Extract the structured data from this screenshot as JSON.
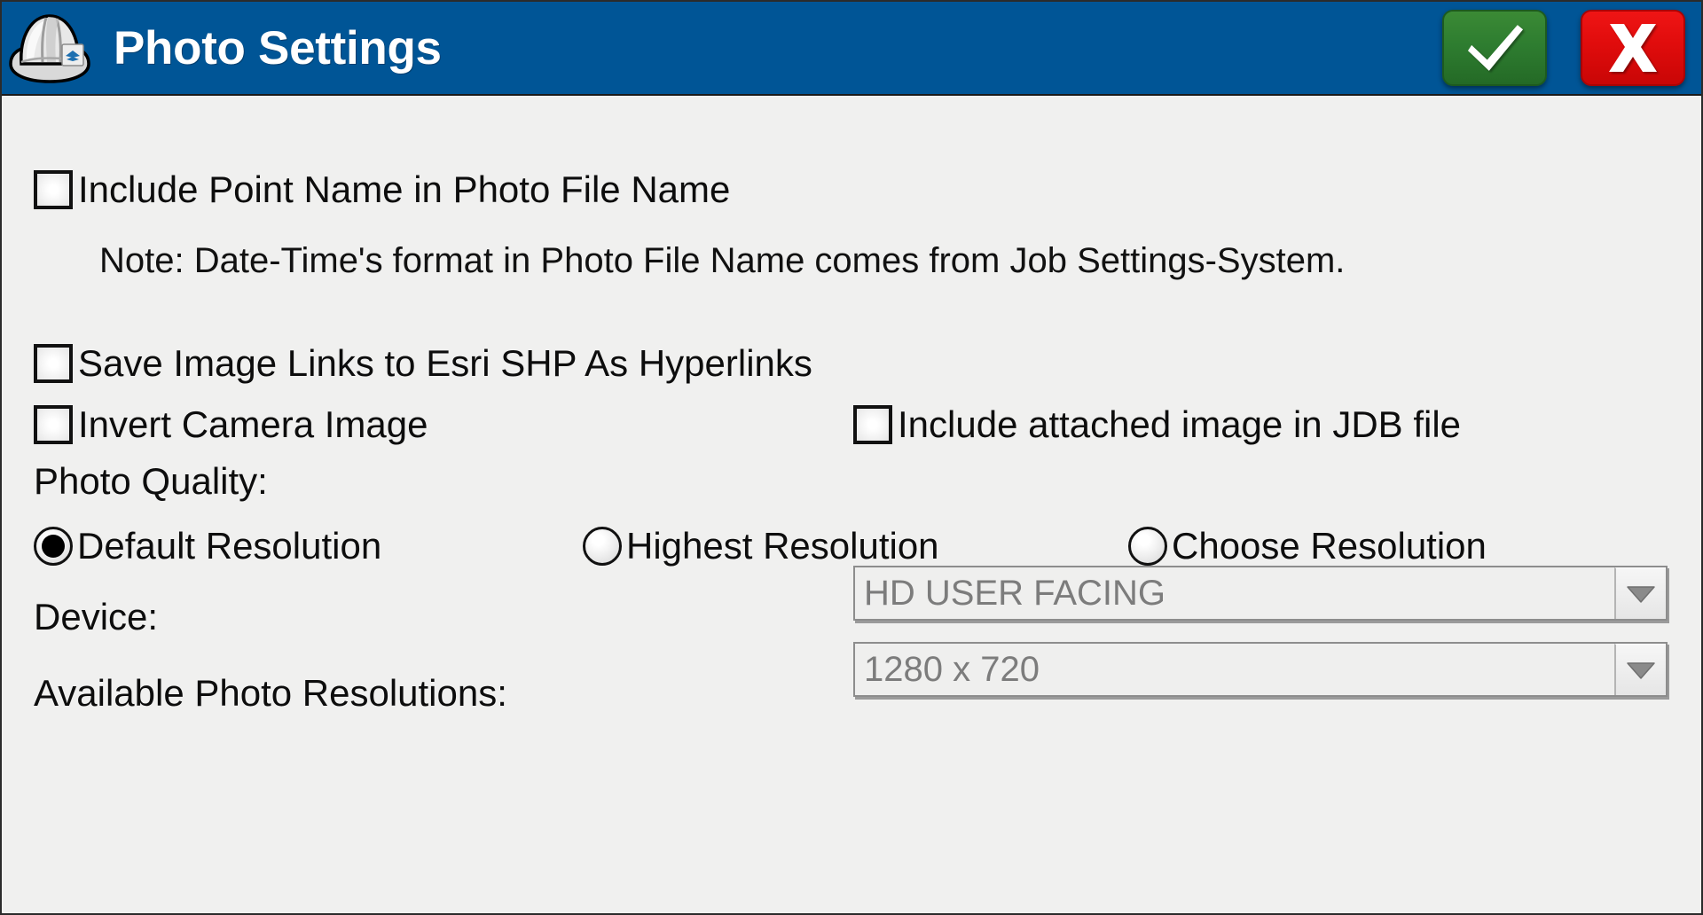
{
  "window": {
    "title": "Photo Settings",
    "icon": "hard-hat-icon",
    "titlebar_color": "#005596",
    "body_color": "#f0f0ef"
  },
  "titlebar": {
    "ok_button": {
      "icon": "checkmark-icon",
      "color": "#2e7d30",
      "label": "OK"
    },
    "cancel_button": {
      "icon": "x-mark-icon",
      "color": "#e00c0c",
      "label": "X"
    }
  },
  "options": {
    "include_point_name": {
      "label": "Include Point Name in Photo File Name",
      "checked": false
    },
    "note": "Note: Date-Time's format in Photo File Name comes from Job Settings-System.",
    "save_image_links": {
      "label": "Save Image Links to Esri SHP As Hyperlinks",
      "checked": false
    },
    "invert_camera_image": {
      "label": "Invert Camera Image",
      "checked": false
    },
    "include_attached_image": {
      "label": "Include attached image in JDB file",
      "checked": false
    }
  },
  "photo_quality": {
    "label": "Photo Quality:",
    "selected": "Default Resolution",
    "choices": [
      {
        "label": "Default Resolution",
        "selected": true
      },
      {
        "label": "Highest Resolution",
        "selected": false
      },
      {
        "label": "Choose Resolution",
        "selected": false
      }
    ]
  },
  "device": {
    "label": "Device:",
    "value": "HD USER FACING",
    "enabled": false
  },
  "resolutions": {
    "label": "Available Photo Resolutions:",
    "value": "1280 x 720",
    "enabled": false
  }
}
